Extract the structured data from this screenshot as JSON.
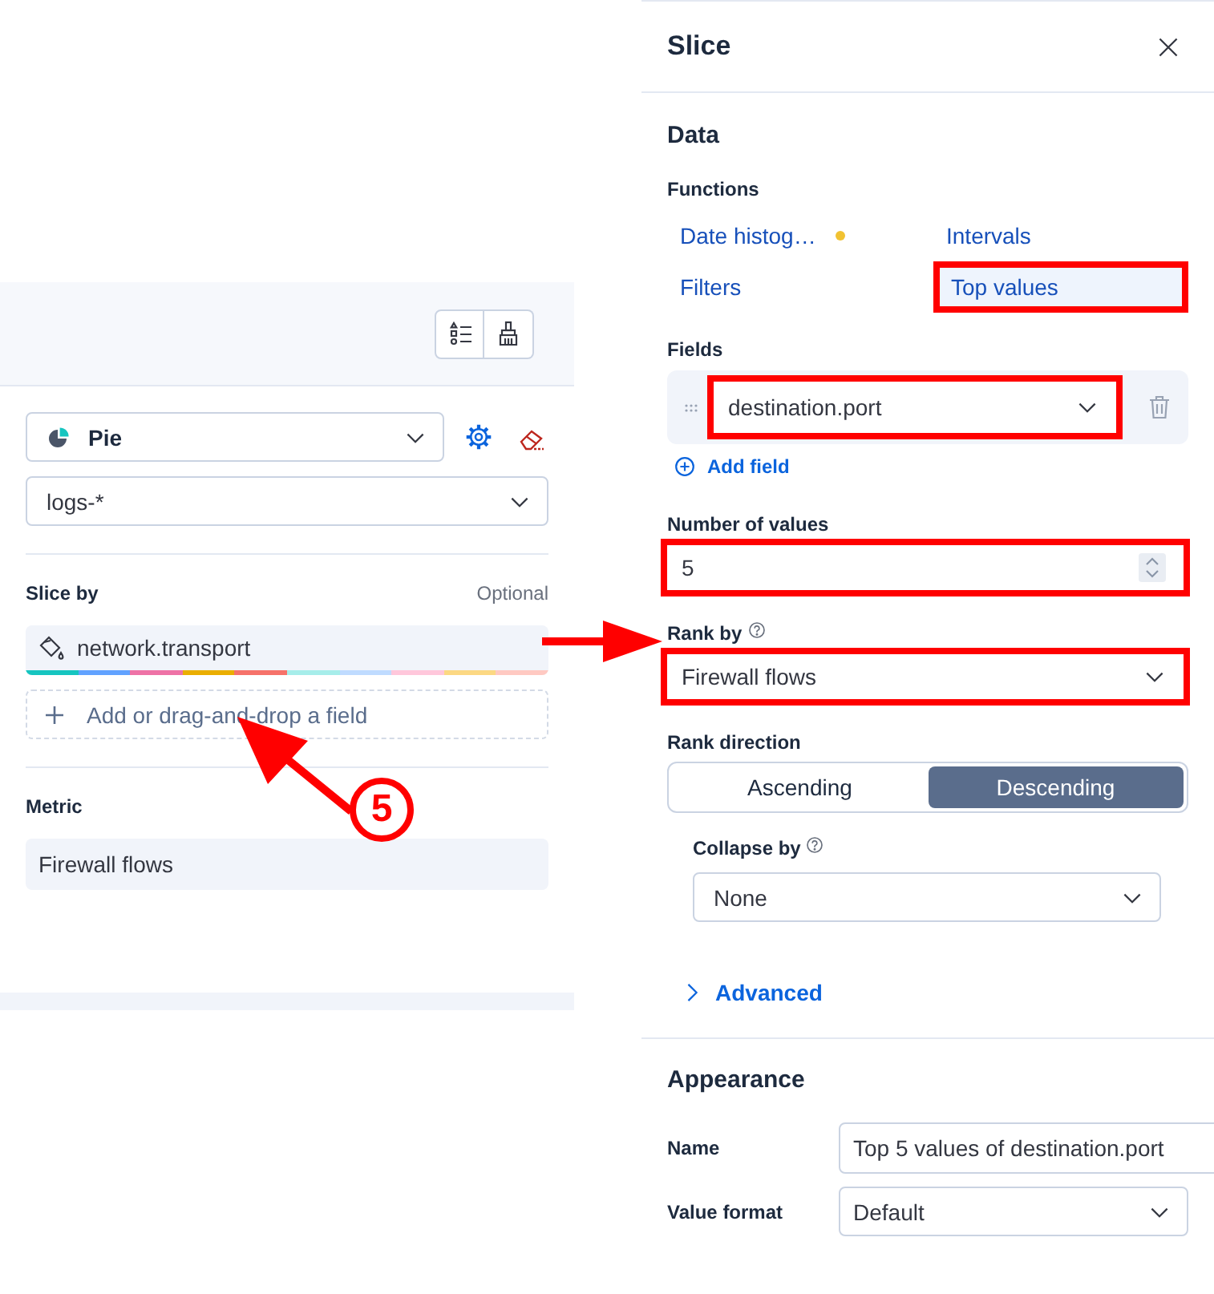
{
  "layer_panel": {
    "chart_type": {
      "label": "Pie"
    },
    "data_view": {
      "value": "logs-*"
    },
    "slice_by": {
      "title": "Slice by",
      "hint": "Optional",
      "fields": [
        {
          "label": "network.transport",
          "palette": [
            {
              "color": "#16c5c0"
            },
            {
              "color": "#61a2ff"
            },
            {
              "color": "#ee72a6"
            },
            {
              "color": "#eaae01"
            },
            {
              "color": "#f6726a"
            },
            {
              "color": "#a6edea"
            },
            {
              "color": "#bfdbff"
            },
            {
              "color": "#ffc7db"
            },
            {
              "color": "#fcd883"
            },
            {
              "color": "#ffc9c2"
            }
          ]
        }
      ],
      "add_label": "Add or drag-and-drop a field"
    },
    "metric": {
      "title": "Metric",
      "fields": [
        {
          "label": "Firewall flows"
        }
      ]
    }
  },
  "flyout": {
    "title": "Slice",
    "data": {
      "title": "Data",
      "functions_label": "Functions",
      "functions": [
        {
          "label": "Date histog…",
          "selected": false,
          "warning": true,
          "highlighted": false
        },
        {
          "label": "Intervals",
          "selected": false,
          "warning": false,
          "highlighted": false
        },
        {
          "label": "Filters",
          "selected": false,
          "warning": false,
          "highlighted": false
        },
        {
          "label": "Top values",
          "selected": true,
          "warning": false,
          "highlighted": true
        }
      ],
      "fields_label": "Fields",
      "fields": [
        {
          "value": "destination.port",
          "highlighted": true
        }
      ],
      "add_field": "Add field",
      "number_of_values": {
        "label": "Number of values",
        "value": "5",
        "highlighted": true
      },
      "rank_by": {
        "label": "Rank by",
        "value": "Firewall flows",
        "highlighted": true
      },
      "rank_direction": {
        "label": "Rank direction",
        "options": [
          {
            "label": "Ascending",
            "selected": false
          },
          {
            "label": "Descending",
            "selected": true
          }
        ]
      },
      "collapse_by": {
        "label": "Collapse by",
        "value": "None"
      },
      "advanced": {
        "label": "Advanced",
        "expanded": false
      }
    },
    "appearance": {
      "title": "Appearance",
      "name": {
        "label": "Name",
        "value": "Top 5 values of destination.port"
      },
      "value_format": {
        "label": "Value format",
        "value": "Default"
      }
    }
  },
  "callout": {
    "number": "5"
  }
}
